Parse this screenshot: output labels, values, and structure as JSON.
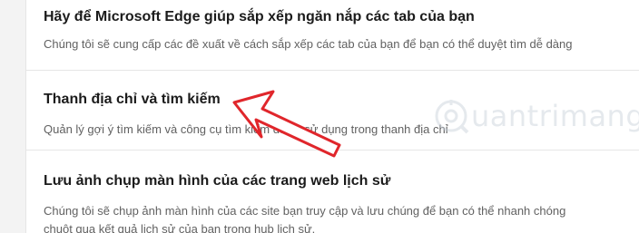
{
  "settings": [
    {
      "title": "Hãy để Microsoft Edge giúp sắp xếp ngăn nắp các tab của bạn",
      "desc": "Chúng tôi sẽ cung cấp các đề xuất về cách sắp xếp các tab của bạn để bạn có thể duyệt tìm dễ dàng"
    },
    {
      "title": "Thanh địa chỉ và tìm kiếm",
      "desc": "Quản lý gợi ý tìm kiếm và công cụ tìm kiếm được sử dụng trong thanh địa chỉ"
    },
    {
      "title": "Lưu ảnh chụp màn hình của các trang web lịch sử",
      "desc_line1": "Chúng tôi sẽ chụp ảnh màn hình của các site bạn truy cập và lưu chúng để bạn có thể nhanh chóng",
      "desc_line2": "chuột qua kết quả lịch sử của bạn trong hub lịch sử."
    }
  ],
  "watermark": {
    "text": "uantrimang"
  },
  "colors": {
    "arrow": "#e0262b",
    "title": "#1b1b1b",
    "desc": "#616161"
  }
}
